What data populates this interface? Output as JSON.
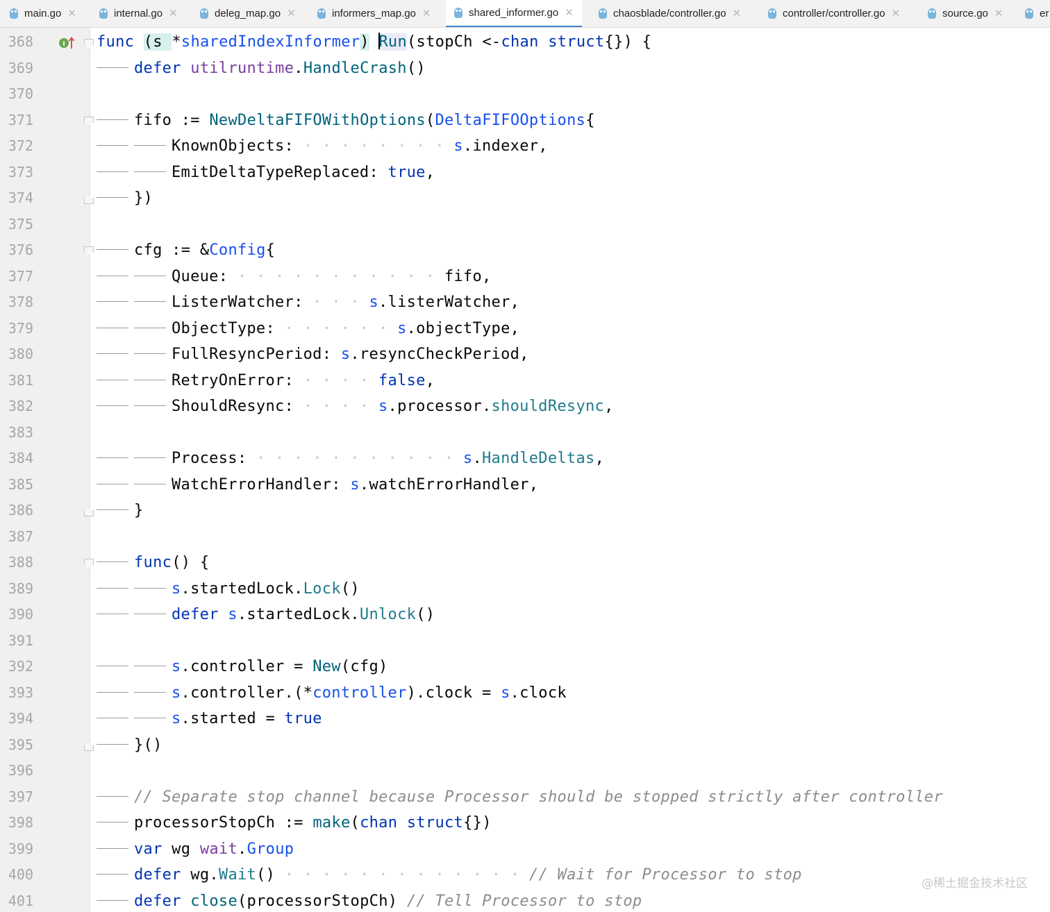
{
  "tabs": [
    {
      "label": "main.go",
      "active": false
    },
    {
      "label": "internal.go",
      "active": false
    },
    {
      "label": "deleg_map.go",
      "active": false
    },
    {
      "label": "informers_map.go",
      "active": false
    },
    {
      "label": "shared_informer.go",
      "active": true
    },
    {
      "label": "chaosblade/controller.go",
      "active": false
    },
    {
      "label": "controller/controller.go",
      "active": false
    },
    {
      "label": "source.go",
      "active": false
    },
    {
      "label": "er",
      "active": false
    }
  ],
  "editor": {
    "lines": [
      {
        "n": "368",
        "text": "func (s *sharedIndexInformer) Run(stopCh <-chan struct{}) {"
      },
      {
        "n": "369",
        "text": "defer utilruntime.HandleCrash()"
      },
      {
        "n": "370",
        "text": ""
      },
      {
        "n": "371",
        "text": "fifo := NewDeltaFIFOWithOptions(DeltaFIFOOptions{"
      },
      {
        "n": "372",
        "text": "KnownObjects: s.indexer,"
      },
      {
        "n": "373",
        "text": "EmitDeltaTypeReplaced: true,"
      },
      {
        "n": "374",
        "text": "})"
      },
      {
        "n": "375",
        "text": ""
      },
      {
        "n": "376",
        "text": "cfg := &Config{"
      },
      {
        "n": "377",
        "text": "Queue: fifo,"
      },
      {
        "n": "378",
        "text": "ListerWatcher: s.listerWatcher,"
      },
      {
        "n": "379",
        "text": "ObjectType: s.objectType,"
      },
      {
        "n": "380",
        "text": "FullResyncPeriod: s.resyncCheckPeriod,"
      },
      {
        "n": "381",
        "text": "RetryOnError: false,"
      },
      {
        "n": "382",
        "text": "ShouldResync: s.processor.shouldResync,"
      },
      {
        "n": "383",
        "text": ""
      },
      {
        "n": "384",
        "text": "Process: s.HandleDeltas,"
      },
      {
        "n": "385",
        "text": "WatchErrorHandler: s.watchErrorHandler,"
      },
      {
        "n": "386",
        "text": "}"
      },
      {
        "n": "387",
        "text": ""
      },
      {
        "n": "388",
        "text": "func() {"
      },
      {
        "n": "389",
        "text": "s.startedLock.Lock()"
      },
      {
        "n": "390",
        "text": "defer s.startedLock.Unlock()"
      },
      {
        "n": "391",
        "text": ""
      },
      {
        "n": "392",
        "text": "s.controller = New(cfg)"
      },
      {
        "n": "393",
        "text": "s.controller.(*controller).clock = s.clock"
      },
      {
        "n": "394",
        "text": "s.started = true"
      },
      {
        "n": "395",
        "text": "}()"
      },
      {
        "n": "396",
        "text": ""
      },
      {
        "n": "397",
        "text": "// Separate stop channel because Processor should be stopped strictly after controller"
      },
      {
        "n": "398",
        "text": "processorStopCh := make(chan struct{})"
      },
      {
        "n": "399",
        "text": "var wg wait.Group"
      },
      {
        "n": "400",
        "text": "defer wg.Wait() // Wait for Processor to stop"
      },
      {
        "n": "401",
        "text": "defer close(processorStopCh) // Tell Processor to stop"
      }
    ],
    "tokens": {
      "l368_func": "func",
      "l368_recv_open": "(s ",
      "l368_star": "*",
      "l368_type": "sharedIndexInformer",
      "l368_recv_close": ")",
      "l368_run": "Run",
      "l368_params": "(stopCh <-",
      "l368_chan": "chan",
      "l368_struct": "struct",
      "l368_tail": "{}) {",
      "l369_defer": "defer",
      "l369_pkg": "utilruntime",
      "l369_dot": ".",
      "l369_fn": "HandleCrash",
      "l369_tail": "()",
      "l371_var": "fifo := ",
      "l371_fn": "NewDeltaFIFOWithOptions",
      "l371_paren": "(",
      "l371_type": "DeltaFIFOOptions",
      "l371_brace": "{",
      "l372_key": "KnownObjects:",
      "l372_dots": " · · · · · · · · ",
      "l372_s": "s",
      "l372_rest": ".indexer,",
      "l373_key": "EmitDeltaTypeReplaced: ",
      "l373_val": "true",
      "l373_comma": ",",
      "l374_text": "})",
      "l376_var": "cfg := &",
      "l376_type": "Config",
      "l376_brace": "{",
      "l377_key": "Queue:",
      "l377_dots": " · · · · · · · · · · · ",
      "l377_val": "fifo,",
      "l378_key": "ListerWatcher:",
      "l378_dots": " · · · ",
      "l378_s": "s",
      "l378_rest": ".listerWatcher,",
      "l379_key": "ObjectType:",
      "l379_dots": " · · · · · · ",
      "l379_s": "s",
      "l379_rest": ".objectType,",
      "l380_key": "FullResyncPeriod: ",
      "l380_s": "s",
      "l380_rest": ".resyncCheckPeriod,",
      "l381_key": "RetryOnError:",
      "l381_dots": " · · · · ",
      "l381_val": "false",
      "l381_comma": ",",
      "l382_key": "ShouldResync:",
      "l382_dots": " · · · · ",
      "l382_s": "s",
      "l382_mid": ".processor.",
      "l382_fn": "shouldResync",
      "l382_comma": ",",
      "l384_key": "Process:",
      "l384_dots": " · · · · · · · · · · · ",
      "l384_s": "s",
      "l384_dot": ".",
      "l384_fn": "HandleDeltas",
      "l384_comma": ",",
      "l385_key": "WatchErrorHandler: ",
      "l385_s": "s",
      "l385_rest": ".watchErrorHandler,",
      "l386_text": "}",
      "l388_func": "func",
      "l388_tail": "() {",
      "l389_s": "s",
      "l389_mid": ".startedLock.",
      "l389_fn": "Lock",
      "l389_tail": "()",
      "l390_defer": "defer",
      "l390_s": " s",
      "l390_mid": ".startedLock.",
      "l390_fn": "Unlock",
      "l390_tail": "()",
      "l392_s": "s",
      "l392_mid": ".controller = ",
      "l392_fn": "New",
      "l392_tail": "(cfg)",
      "l393_s": "s",
      "l393_mid": ".controller.(*",
      "l393_type": "controller",
      "l393_mid2": ").clock = ",
      "l393_s2": "s",
      "l393_tail": ".clock",
      "l394_s": "s",
      "l394_mid": ".started = ",
      "l394_val": "true",
      "l395_text": "}()",
      "l397_comment": "// Separate stop channel because Processor should be stopped strictly after controller",
      "l398_var": "processorStopCh := ",
      "l398_fn": "make",
      "l398_paren": "(",
      "l398_chan": "chan",
      "l398_struct": " struct",
      "l398_tail": "{})",
      "l399_var": "var",
      "l399_name": " wg ",
      "l399_pkg": "wait",
      "l399_dot": ".",
      "l399_type": "Group",
      "l400_defer": "defer",
      "l400_name": " wg.",
      "l400_fn": "Wait",
      "l400_tail": "()",
      "l400_dots": " · · · · · · · · · · · · · ",
      "l400_comment": "// Wait for Processor to stop",
      "l401_defer": "defer",
      "l401_sp": " ",
      "l401_fn": "close",
      "l401_tail": "(processorStopCh) ",
      "l401_comment": "// Tell Processor to stop"
    }
  },
  "gutter": {
    "icons": [
      "implementation-up-icon"
    ]
  },
  "watermark": "@稀土掘金技术社区",
  "colors": {
    "keyword": "#0033b3",
    "function": "#00627a",
    "type": "#1750eb",
    "comment": "#8c8c8c",
    "active_tab_underline": "#4083c9"
  }
}
